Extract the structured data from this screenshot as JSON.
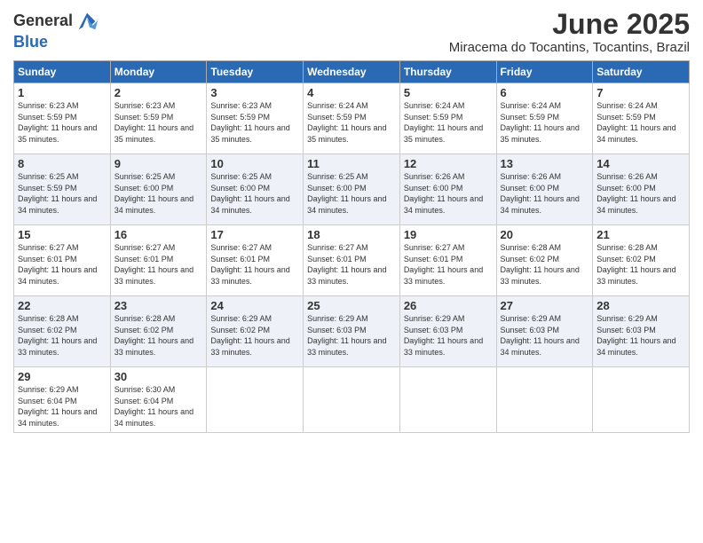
{
  "logo": {
    "line1": "General",
    "line2": "Blue"
  },
  "title": "June 2025",
  "subtitle": "Miracema do Tocantins, Tocantins, Brazil",
  "headers": [
    "Sunday",
    "Monday",
    "Tuesday",
    "Wednesday",
    "Thursday",
    "Friday",
    "Saturday"
  ],
  "weeks": [
    [
      {
        "day": "1",
        "sunrise": "6:23 AM",
        "sunset": "5:59 PM",
        "daylight": "11 hours and 35 minutes."
      },
      {
        "day": "2",
        "sunrise": "6:23 AM",
        "sunset": "5:59 PM",
        "daylight": "11 hours and 35 minutes."
      },
      {
        "day": "3",
        "sunrise": "6:23 AM",
        "sunset": "5:59 PM",
        "daylight": "11 hours and 35 minutes."
      },
      {
        "day": "4",
        "sunrise": "6:24 AM",
        "sunset": "5:59 PM",
        "daylight": "11 hours and 35 minutes."
      },
      {
        "day": "5",
        "sunrise": "6:24 AM",
        "sunset": "5:59 PM",
        "daylight": "11 hours and 35 minutes."
      },
      {
        "day": "6",
        "sunrise": "6:24 AM",
        "sunset": "5:59 PM",
        "daylight": "11 hours and 35 minutes."
      },
      {
        "day": "7",
        "sunrise": "6:24 AM",
        "sunset": "5:59 PM",
        "daylight": "11 hours and 34 minutes."
      }
    ],
    [
      {
        "day": "8",
        "sunrise": "6:25 AM",
        "sunset": "5:59 PM",
        "daylight": "11 hours and 34 minutes."
      },
      {
        "day": "9",
        "sunrise": "6:25 AM",
        "sunset": "6:00 PM",
        "daylight": "11 hours and 34 minutes."
      },
      {
        "day": "10",
        "sunrise": "6:25 AM",
        "sunset": "6:00 PM",
        "daylight": "11 hours and 34 minutes."
      },
      {
        "day": "11",
        "sunrise": "6:25 AM",
        "sunset": "6:00 PM",
        "daylight": "11 hours and 34 minutes."
      },
      {
        "day": "12",
        "sunrise": "6:26 AM",
        "sunset": "6:00 PM",
        "daylight": "11 hours and 34 minutes."
      },
      {
        "day": "13",
        "sunrise": "6:26 AM",
        "sunset": "6:00 PM",
        "daylight": "11 hours and 34 minutes."
      },
      {
        "day": "14",
        "sunrise": "6:26 AM",
        "sunset": "6:00 PM",
        "daylight": "11 hours and 34 minutes."
      }
    ],
    [
      {
        "day": "15",
        "sunrise": "6:27 AM",
        "sunset": "6:01 PM",
        "daylight": "11 hours and 34 minutes."
      },
      {
        "day": "16",
        "sunrise": "6:27 AM",
        "sunset": "6:01 PM",
        "daylight": "11 hours and 33 minutes."
      },
      {
        "day": "17",
        "sunrise": "6:27 AM",
        "sunset": "6:01 PM",
        "daylight": "11 hours and 33 minutes."
      },
      {
        "day": "18",
        "sunrise": "6:27 AM",
        "sunset": "6:01 PM",
        "daylight": "11 hours and 33 minutes."
      },
      {
        "day": "19",
        "sunrise": "6:27 AM",
        "sunset": "6:01 PM",
        "daylight": "11 hours and 33 minutes."
      },
      {
        "day": "20",
        "sunrise": "6:28 AM",
        "sunset": "6:02 PM",
        "daylight": "11 hours and 33 minutes."
      },
      {
        "day": "21",
        "sunrise": "6:28 AM",
        "sunset": "6:02 PM",
        "daylight": "11 hours and 33 minutes."
      }
    ],
    [
      {
        "day": "22",
        "sunrise": "6:28 AM",
        "sunset": "6:02 PM",
        "daylight": "11 hours and 33 minutes."
      },
      {
        "day": "23",
        "sunrise": "6:28 AM",
        "sunset": "6:02 PM",
        "daylight": "11 hours and 33 minutes."
      },
      {
        "day": "24",
        "sunrise": "6:29 AM",
        "sunset": "6:02 PM",
        "daylight": "11 hours and 33 minutes."
      },
      {
        "day": "25",
        "sunrise": "6:29 AM",
        "sunset": "6:03 PM",
        "daylight": "11 hours and 33 minutes."
      },
      {
        "day": "26",
        "sunrise": "6:29 AM",
        "sunset": "6:03 PM",
        "daylight": "11 hours and 33 minutes."
      },
      {
        "day": "27",
        "sunrise": "6:29 AM",
        "sunset": "6:03 PM",
        "daylight": "11 hours and 34 minutes."
      },
      {
        "day": "28",
        "sunrise": "6:29 AM",
        "sunset": "6:03 PM",
        "daylight": "11 hours and 34 minutes."
      }
    ],
    [
      {
        "day": "29",
        "sunrise": "6:29 AM",
        "sunset": "6:04 PM",
        "daylight": "11 hours and 34 minutes."
      },
      {
        "day": "30",
        "sunrise": "6:30 AM",
        "sunset": "6:04 PM",
        "daylight": "11 hours and 34 minutes."
      },
      null,
      null,
      null,
      null,
      null
    ]
  ]
}
